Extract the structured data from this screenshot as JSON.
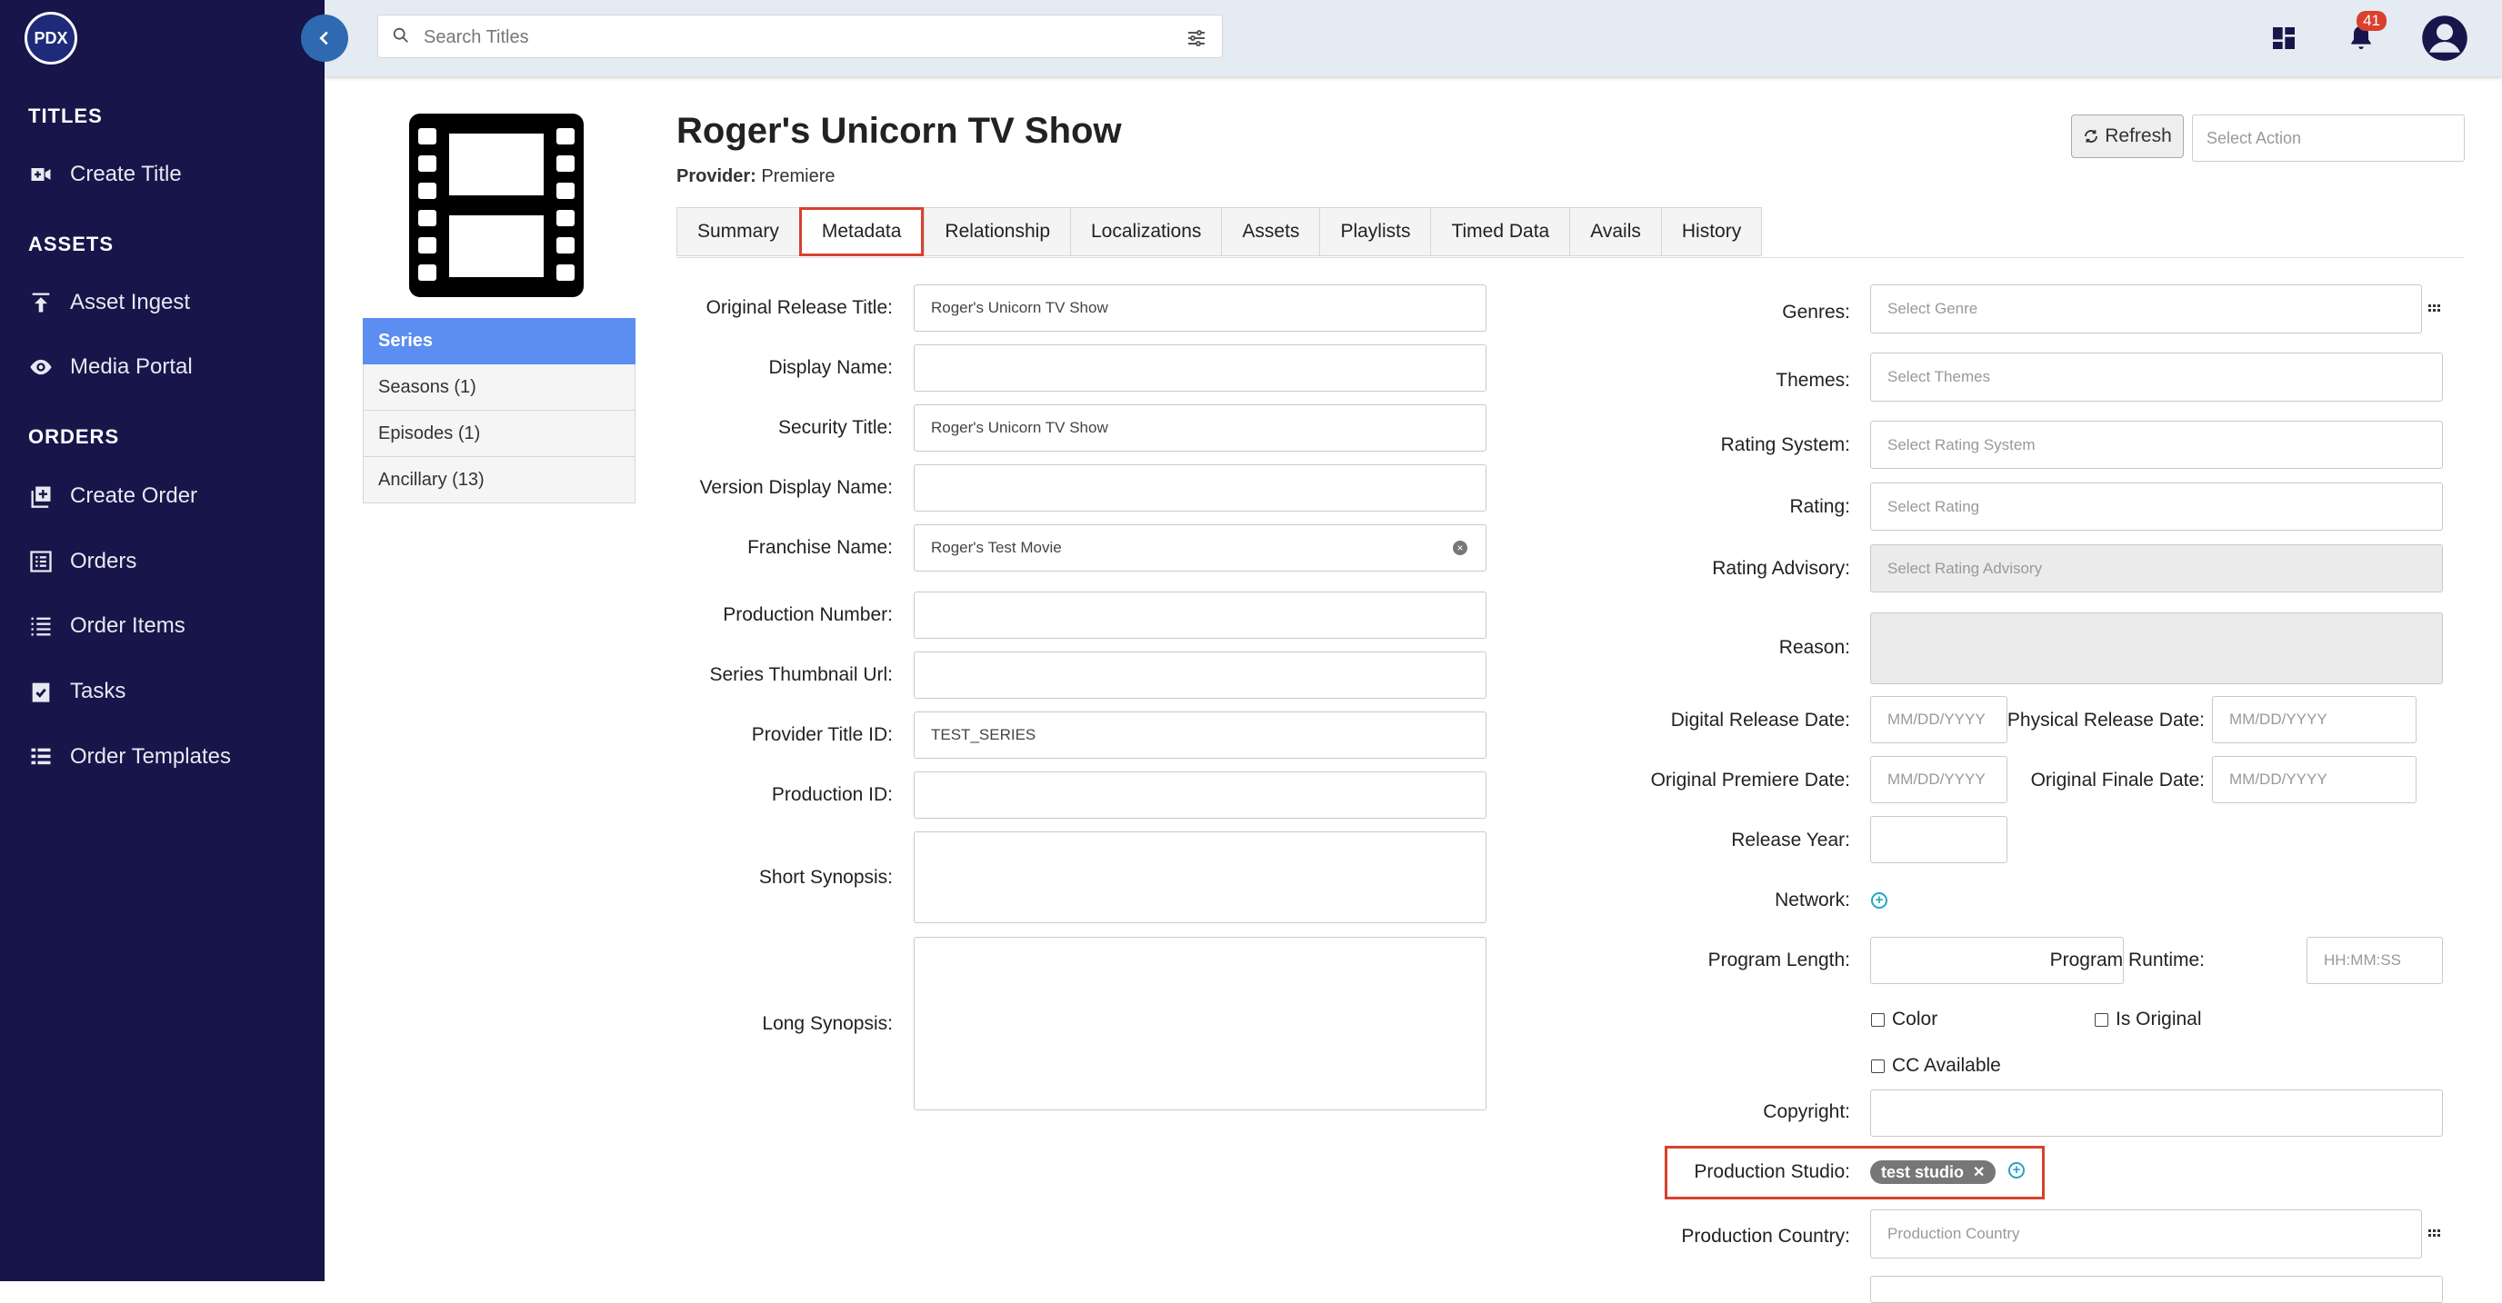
{
  "sidebar": {
    "logo": "PDX",
    "sections": [
      {
        "heading": "TITLES",
        "items": [
          {
            "label": "Create Title",
            "icon": "video-plus-icon"
          }
        ]
      },
      {
        "heading": "ASSETS",
        "items": [
          {
            "label": "Asset Ingest",
            "icon": "upload-icon"
          },
          {
            "label": "Media Portal",
            "icon": "eye-icon"
          }
        ]
      },
      {
        "heading": "ORDERS",
        "items": [
          {
            "label": "Create Order",
            "icon": "add-box-icon"
          },
          {
            "label": "Orders",
            "icon": "list-box-icon"
          },
          {
            "label": "Order Items",
            "icon": "list-icon"
          },
          {
            "label": "Tasks",
            "icon": "clipboard-check-icon"
          },
          {
            "label": "Order Templates",
            "icon": "table-list-icon"
          }
        ]
      }
    ]
  },
  "topbar": {
    "search_placeholder": "Search Titles",
    "notification_count": "41"
  },
  "title": {
    "name": "Roger's Unicorn TV Show",
    "provider_label": "Provider:",
    "provider_value": "Premiere",
    "refresh_label": "Refresh",
    "action_placeholder": "Select Action"
  },
  "subnav": [
    {
      "label": "Series",
      "active": true
    },
    {
      "label": "Seasons (1)"
    },
    {
      "label": "Episodes (1)"
    },
    {
      "label": "Ancillary (13)"
    }
  ],
  "tabs": [
    "Summary",
    "Metadata",
    "Relationship",
    "Localizations",
    "Assets",
    "Playlists",
    "Timed Data",
    "Avails",
    "History"
  ],
  "active_tab": "Metadata",
  "left_form": {
    "original_release_title": {
      "label": "Original Release Title:",
      "value": "Roger's Unicorn TV Show"
    },
    "display_name": {
      "label": "Display Name:",
      "value": ""
    },
    "security_title": {
      "label": "Security Title:",
      "value": "Roger's Unicorn TV Show"
    },
    "version_display_name": {
      "label": "Version Display Name:",
      "value": ""
    },
    "franchise_name": {
      "label": "Franchise Name:",
      "value": "Roger's Test Movie"
    },
    "production_number": {
      "label": "Production Number:",
      "value": ""
    },
    "series_thumbnail_url": {
      "label": "Series Thumbnail Url:",
      "value": ""
    },
    "provider_title_id": {
      "label": "Provider Title ID:",
      "value": "TEST_SERIES"
    },
    "production_id": {
      "label": "Production ID:",
      "value": ""
    },
    "short_synopsis": {
      "label": "Short Synopsis:",
      "value": ""
    },
    "long_synopsis": {
      "label": "Long Synopsis:",
      "value": ""
    }
  },
  "right_form": {
    "genres": {
      "label": "Genres:",
      "placeholder": "Select Genre"
    },
    "themes": {
      "label": "Themes:",
      "placeholder": "Select Themes"
    },
    "rating_system": {
      "label": "Rating System:",
      "placeholder": "Select Rating System"
    },
    "rating": {
      "label": "Rating:",
      "placeholder": "Select Rating"
    },
    "rating_advisory": {
      "label": "Rating Advisory:",
      "placeholder": "Select Rating Advisory"
    },
    "reason": {
      "label": "Reason:"
    },
    "digital_release_date": {
      "label": "Digital Release Date:",
      "placeholder": "MM/DD/YYYY"
    },
    "physical_release_date": {
      "label": "Physical Release Date:",
      "placeholder": "MM/DD/YYYY"
    },
    "original_premiere_date": {
      "label": "Original Premiere Date:",
      "placeholder": "MM/DD/YYYY"
    },
    "original_finale_date": {
      "label": "Original Finale Date:",
      "placeholder": "MM/DD/YYYY"
    },
    "release_year": {
      "label": "Release Year:"
    },
    "network": {
      "label": "Network:"
    },
    "program_length": {
      "label": "Program Length:"
    },
    "program_runtime": {
      "label": "Program Runtime:",
      "placeholder": "HH:MM:SS"
    },
    "color": {
      "label": "Color",
      "checked": false
    },
    "is_original": {
      "label": "Is Original",
      "checked": false
    },
    "cc_available": {
      "label": "CC Available",
      "checked": false
    },
    "copyright": {
      "label": "Copyright:"
    },
    "production_studio": {
      "label": "Production Studio:",
      "chip": "test studio"
    },
    "production_country": {
      "label": "Production Country:",
      "placeholder": "Production Country"
    }
  },
  "colors": {
    "sidebar": "#17154a",
    "accent": "#5b8ef0",
    "highlight": "#d9412c",
    "topbar": "#e4ebf3"
  }
}
